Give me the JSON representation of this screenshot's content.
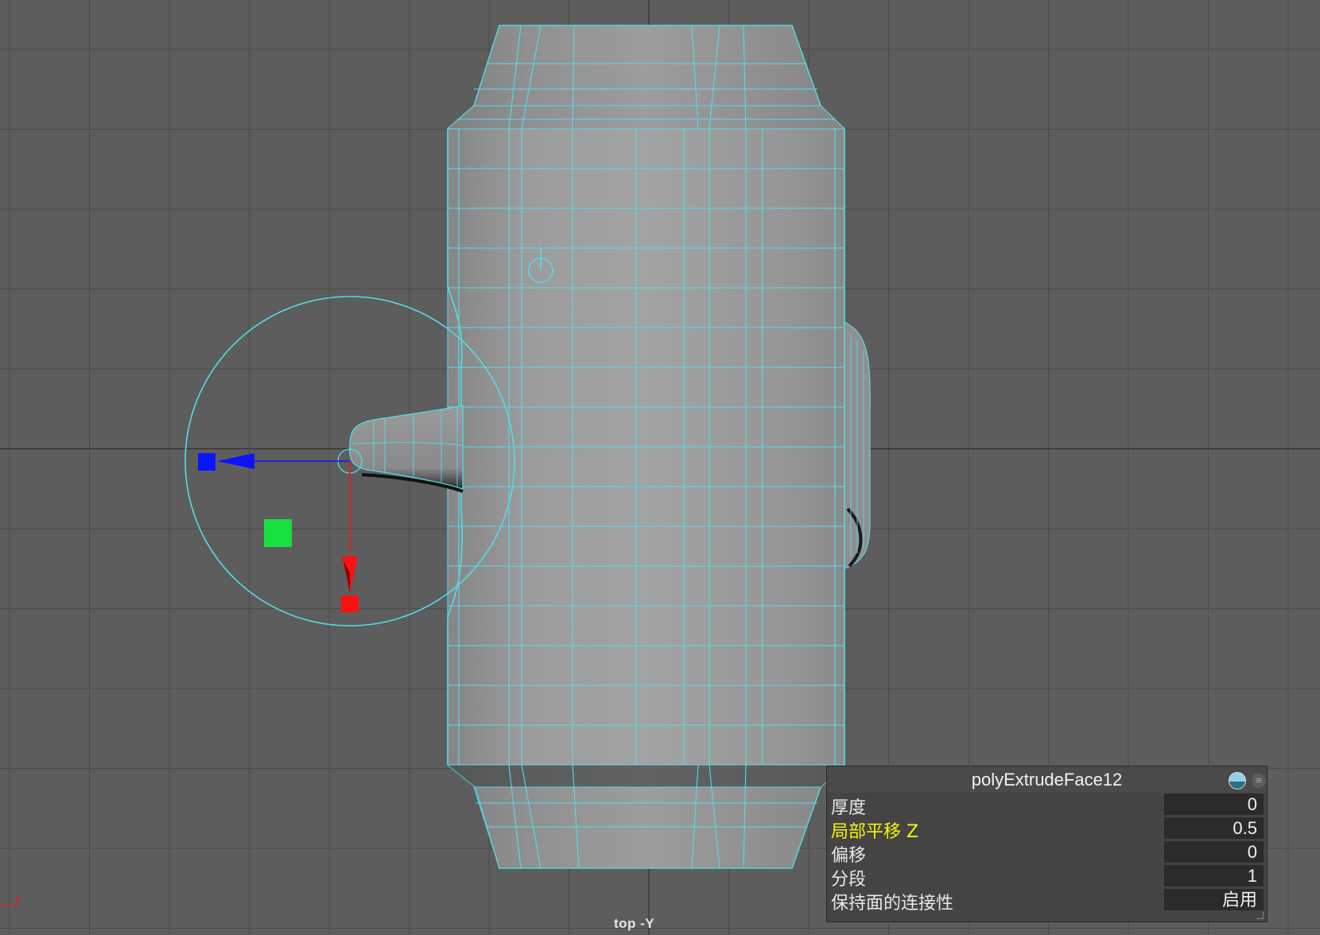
{
  "viewport": {
    "camera_label": "top -Y",
    "axis_indicator": "x",
    "wire_color": "#55dbe8",
    "object_fill": "#9a9a9a",
    "manipulator_colors": {
      "x": "#ff1010",
      "z": "#0a14ff",
      "center": "#18e040"
    }
  },
  "channel_box": {
    "title": "polyExtrudeFace12",
    "header_icons": [
      "pie-chart-icon",
      "menu-icon"
    ],
    "rows": [
      {
        "label": "厚度",
        "value": "0",
        "highlighted": false
      },
      {
        "label": "局部平移 Z",
        "value": "0.5",
        "highlighted": true
      },
      {
        "label": "偏移",
        "value": "0",
        "highlighted": false
      },
      {
        "label": "分段",
        "value": "1",
        "highlighted": false
      },
      {
        "label": "保持面的连接性",
        "value": "启用",
        "highlighted": false
      }
    ]
  }
}
